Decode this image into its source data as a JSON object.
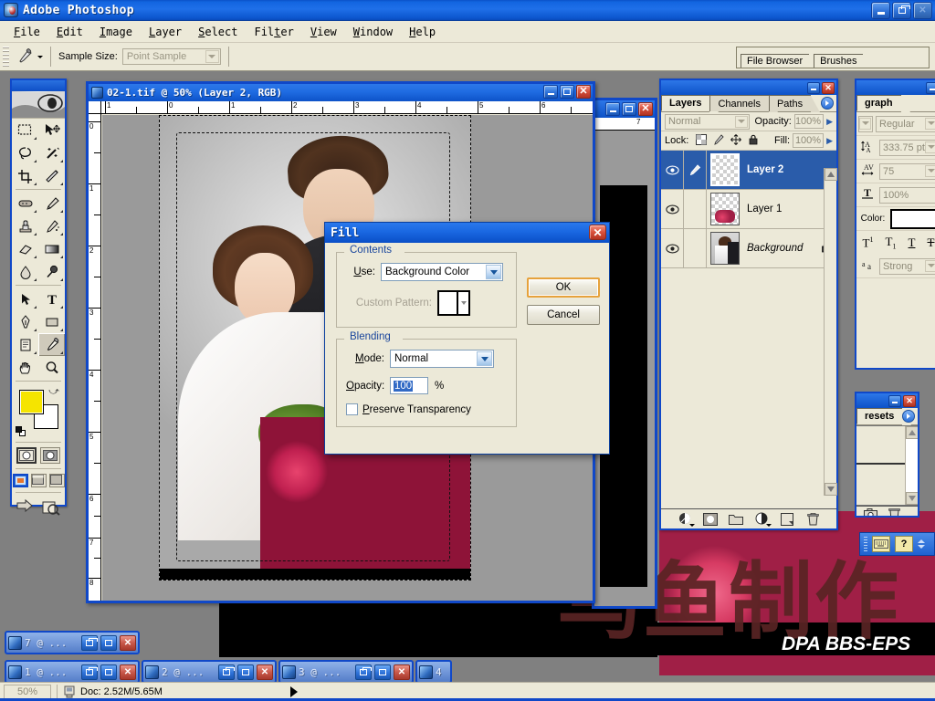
{
  "app": {
    "title": "Adobe Photoshop",
    "icon": "photoshop-icon"
  },
  "window_controls": {
    "minimize": "minimize-icon",
    "restore": "restore-icon",
    "close": "close-icon"
  },
  "menubar": {
    "items": [
      "File",
      "Edit",
      "Image",
      "Layer",
      "Select",
      "Filter",
      "View",
      "Window",
      "Help"
    ]
  },
  "options_bar": {
    "tool_icon": "eyedropper-icon",
    "sample_size_label": "Sample Size:",
    "sample_size_value": "Point Sample"
  },
  "palette_well": {
    "tabs": [
      "File Browser",
      "Brushes"
    ]
  },
  "toolbox": {
    "tools": [
      "marquee-tool",
      "move-tool",
      "lasso-tool",
      "magic-wand-tool",
      "crop-tool",
      "slice-tool",
      "healing-brush-tool",
      "brush-tool",
      "clone-stamp-tool",
      "history-brush-tool",
      "eraser-tool",
      "gradient-tool",
      "blur-tool",
      "dodge-tool",
      "path-selection-tool",
      "type-tool",
      "pen-tool",
      "rectangle-tool",
      "notes-tool",
      "eyedropper-tool",
      "hand-tool",
      "zoom-tool"
    ],
    "selected_tool": "eyedropper-tool",
    "foreground_color": "#f5e400",
    "background_color": "#ffffff",
    "quick_mask": [
      "standard-mode",
      "quick-mask-mode"
    ],
    "screen_modes": [
      "standard-screen-mode",
      "full-screen-menubar-mode",
      "full-screen-mode"
    ],
    "jump_to": [
      "jump-to-imageready-icon",
      "jump-to-browser-icon"
    ]
  },
  "document_window": {
    "title": "02-1.tif @ 50% (Layer 2, RGB)",
    "icon": "document-icon",
    "ruler_h_ticks": [
      "0",
      "1",
      "2",
      "3",
      "4",
      "5",
      "6",
      "7"
    ],
    "ruler_v_ticks": [
      "0",
      "1",
      "2",
      "3",
      "4",
      "5",
      "6",
      "7",
      "8"
    ],
    "controls": {
      "minimize": "minimize-icon",
      "maximize": "maximize-icon",
      "close": "close-icon"
    }
  },
  "fill_dialog": {
    "title": "Fill",
    "close": "close-icon",
    "contents": {
      "legend": "Contents",
      "use_label": "Use:",
      "use_value": "Background Color",
      "custom_pattern_label": "Custom Pattern:",
      "custom_pattern_enabled": false
    },
    "blending": {
      "legend": "Blending",
      "mode_label": "Mode:",
      "mode_value": "Normal",
      "opacity_label": "Opacity:",
      "opacity_value": "100",
      "opacity_unit": "%",
      "preserve_label": "Preserve Transparency",
      "preserve_checked": false
    },
    "buttons": {
      "ok": "OK",
      "cancel": "Cancel"
    }
  },
  "layers_palette": {
    "tabs": [
      "Layers",
      "Channels",
      "Paths"
    ],
    "active_tab": "Layers",
    "blend_mode": "Normal",
    "opacity_label": "Opacity:",
    "opacity_value": "100%",
    "lock_label": "Lock:",
    "lock_icons": [
      "lock-transparency-icon",
      "lock-image-icon",
      "lock-position-icon",
      "lock-all-icon"
    ],
    "fill_label": "Fill:",
    "fill_value": "100%",
    "layers": [
      {
        "name": "Layer 2",
        "visible": true,
        "selected": true,
        "linked": false,
        "locked": false,
        "thumb": "transparent-thumb"
      },
      {
        "name": "Layer 1",
        "visible": true,
        "selected": false,
        "linked": false,
        "locked": false,
        "thumb": "roses-thumb"
      },
      {
        "name": "Background",
        "visible": true,
        "selected": false,
        "linked": false,
        "locked": true,
        "thumb": "couple-thumb"
      }
    ],
    "bottom_buttons": [
      "layer-style-icon",
      "layer-mask-icon",
      "new-group-icon",
      "adjustment-layer-icon",
      "new-layer-icon",
      "delete-layer-icon"
    ]
  },
  "character_palette": {
    "tab": "graph",
    "font_style": "Regular",
    "leading_icon": "leading-icon",
    "leading_value": "333.75 pt",
    "tracking_icon": "tracking-icon",
    "tracking_value": "75",
    "vertical_scale_icon": "vertical-scale-icon",
    "vertical_scale_value": "100%",
    "color_label": "Color:",
    "color_value": "#ffffff",
    "type_buttons": [
      "superscript-icon",
      "subscript-icon",
      "underline-icon",
      "strikethrough-icon"
    ],
    "anti_alias_icon": "anti-alias-icon",
    "anti_alias_value": "Strong"
  },
  "presets_palette": {
    "tab": "resets",
    "buttons": [
      "new-preset-icon",
      "delete-preset-icon"
    ]
  },
  "ime_toolbar": {
    "buttons": [
      "keyboard-icon",
      "help-icon"
    ],
    "grip": "grip-icon"
  },
  "minimized_documents": [
    {
      "title": "7 @ ...",
      "row": 1
    },
    {
      "title": "1 @ ...",
      "row": 2
    },
    {
      "title": "2 @ ...",
      "row": 2
    },
    {
      "title": "3 @ ...",
      "row": 2
    },
    {
      "title": "4",
      "row": 2
    }
  ],
  "status_bar": {
    "zoom": "50%",
    "doc_icon": "document-size-icon",
    "doc_info": "Doc: 2.52M/5.65M",
    "more_arrow": "play-arrow-icon"
  },
  "watermarks": {
    "chinese": "乌鱼制作",
    "english": "DPA BBS-EPS"
  },
  "colors": {
    "titlebar_blue": "#1f6fe8",
    "palette_beige": "#ece9d8",
    "selection_blue": "#2a5caa",
    "accent_orange": "#e6a23c",
    "desktop_gray": "#808080"
  }
}
